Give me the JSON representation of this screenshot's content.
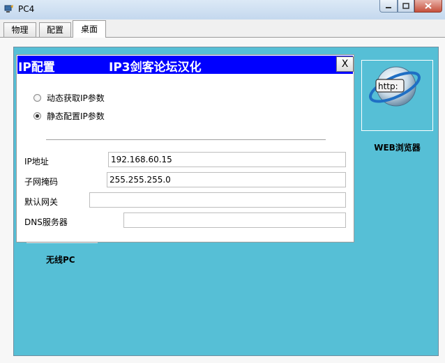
{
  "window": {
    "title": "PC4"
  },
  "tabs": [
    {
      "label": "物理"
    },
    {
      "label": "配置"
    },
    {
      "label": "桌面"
    }
  ],
  "active_tab": "桌面",
  "desktop": {
    "web_browser_label": "WEB浏览器",
    "web_browser_icon_text": "http:",
    "wireless_label": "无线PC"
  },
  "ip_dialog": {
    "title": "IP配置",
    "subtitle": "IP3剑客论坛汉化",
    "close_label": "X",
    "dhcp_label": "动态获取IP参数",
    "static_label": "静态配置IP参数",
    "selected_mode": "static",
    "fields": {
      "ip_label": "IP地址",
      "ip_value": "192.168.60.15",
      "mask_label": "子网掩码",
      "mask_value": "255.255.255.0",
      "gateway_label": "默认网关",
      "gateway_value": "",
      "dns_label": "DNS服务器",
      "dns_value": ""
    }
  },
  "colors": {
    "desktop_bg": "#56bfd6",
    "dialog_titlebar": "#0000ff"
  }
}
